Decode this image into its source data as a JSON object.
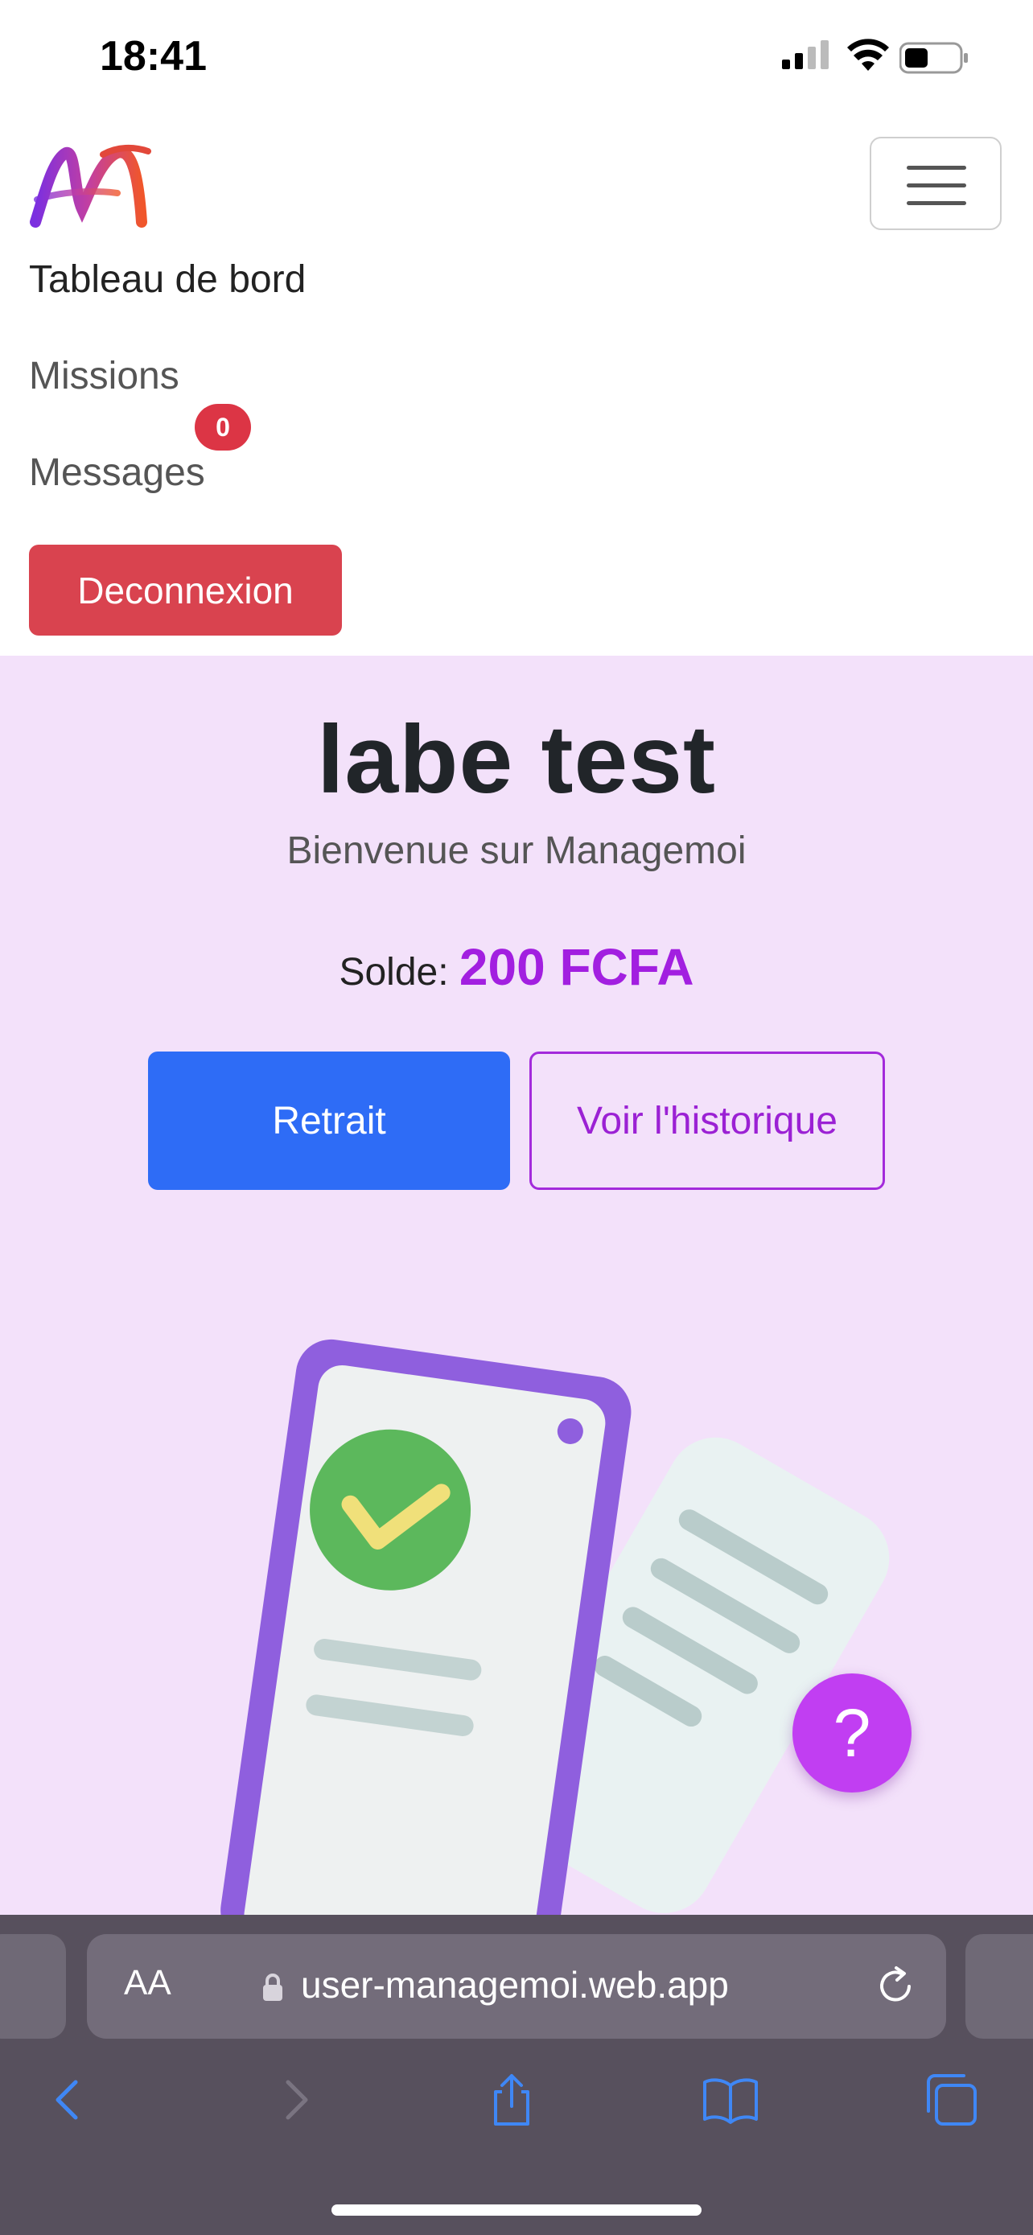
{
  "status_bar": {
    "time": "18:41"
  },
  "navbar": {
    "brand_icon": "managemoi-logo",
    "menu_icon": "hamburger-menu-icon",
    "links": [
      {
        "label": "Tableau de bord"
      },
      {
        "label": "Missions"
      },
      {
        "label": "Messages",
        "badge": "0"
      }
    ],
    "logout_label": "Deconnexion"
  },
  "main": {
    "user_name": "labe test",
    "welcome": "Bienvenue sur Managemoi",
    "balance_label": "Solde:",
    "balance_value": "200 FCFA",
    "withdraw_label": "Retrait",
    "history_label": "Voir l'historique",
    "help_label": "?"
  },
  "browser": {
    "text_size_label": "AA",
    "url": "user-managemoi.web.app"
  },
  "colors": {
    "accent_purple": "#a21fe0",
    "primary_blue": "#2e6cf6",
    "danger_red": "#d9434f",
    "section_bg": "#f3e1fa"
  }
}
